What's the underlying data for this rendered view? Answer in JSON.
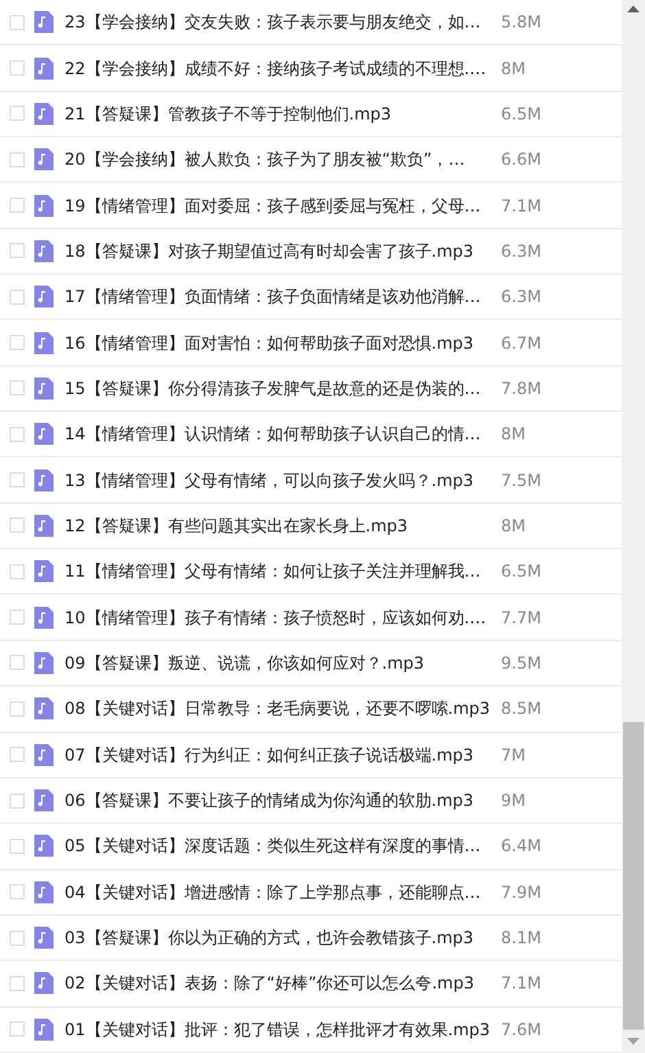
{
  "files": [
    {
      "name": "23【学会接纳】交友失败：孩子表示要与朋友绝交，如…",
      "size": "5.8M",
      "checked": false
    },
    {
      "name": "22【学会接纳】成绩不好：接纳孩子考试成绩的不理想.…",
      "size": "8M",
      "checked": false
    },
    {
      "name": "21【答疑课】管教孩子不等于控制他们.mp3",
      "size": "6.5M",
      "checked": false
    },
    {
      "name": "20【学会接纳】被人欺负：孩子为了朋友被“欺负”，…",
      "size": "6.6M",
      "checked": false
    },
    {
      "name": "19【情绪管理】面对委屈：孩子感到委屈与冤枉，父母…",
      "size": "7.1M",
      "checked": false
    },
    {
      "name": "18【答疑课】对孩子期望值过高有时却会害了孩子.mp3",
      "size": "6.3M",
      "checked": false
    },
    {
      "name": "17【情绪管理】负面情绪：孩子负面情绪是该劝他消解…",
      "size": "6.3M",
      "checked": false
    },
    {
      "name": "16【情绪管理】面对害怕：如何帮助孩子面对恐惧.mp3",
      "size": "6.7M",
      "checked": false
    },
    {
      "name": "15【答疑课】你分得清孩子发脾气是故意的还是伪装的…",
      "size": "7.8M",
      "checked": false
    },
    {
      "name": "14【情绪管理】认识情绪：如何帮助孩子认识自己的情…",
      "size": "8M",
      "checked": false
    },
    {
      "name": "13【情绪管理】父母有情绪，可以向孩子发火吗？.mp3",
      "size": "7.5M",
      "checked": false
    },
    {
      "name": "12【答疑课】有些问题其实出在家长身上.mp3",
      "size": "8M",
      "checked": false
    },
    {
      "name": "11【情绪管理】父母有情绪：如何让孩子关注并理解我…",
      "size": "6.5M",
      "checked": false
    },
    {
      "name": "10【情绪管理】孩子有情绪：孩子愤怒时，应该如何劝.…",
      "size": "7.7M",
      "checked": false
    },
    {
      "name": "09【答疑课】叛逆、说谎，你该如何应对？.mp3",
      "size": "9.5M",
      "checked": false
    },
    {
      "name": "08【关键对话】日常教导：老毛病要说，还要不啰嗦.mp3",
      "size": "8.5M",
      "checked": false
    },
    {
      "name": "07【关键对话】行为纠正：如何纠正孩子说话极端.mp3",
      "size": "7M",
      "checked": false
    },
    {
      "name": "06【答疑课】不要让孩子的情绪成为你沟通的软肋.mp3",
      "size": "9M",
      "checked": false
    },
    {
      "name": "05【关键对话】深度话题：类似生死这样有深度的事情…",
      "size": "6.4M",
      "checked": false
    },
    {
      "name": "04【关键对话】增进感情：除了上学那点事，还能聊点…",
      "size": "7.9M",
      "checked": false
    },
    {
      "name": "03【答疑课】你以为正确的方式，也许会教错孩子.mp3",
      "size": "8.1M",
      "checked": false
    },
    {
      "name": "02【关键对话】表扬：除了“好棒”你还可以怎么夸.mp3",
      "size": "7.1M",
      "checked": false
    },
    {
      "name": "01【关键对话】批评：犯了错误，怎样批评才有效果.mp3",
      "size": "7.6M",
      "checked": false
    }
  ]
}
